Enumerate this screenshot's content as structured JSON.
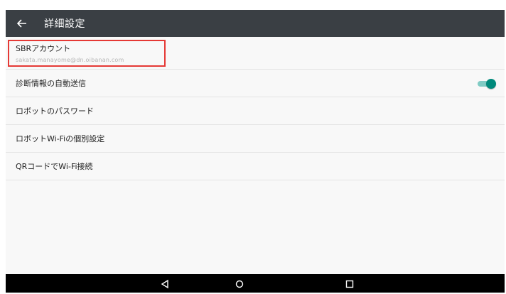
{
  "header": {
    "title": "詳細設定",
    "back_icon": "arrow-left-icon"
  },
  "settings": {
    "account": {
      "label": "SBRアカウント",
      "email": "sakata.manayome@dn.oibanan.com"
    },
    "items": [
      {
        "label": "診断情報の自動送信",
        "toggle": true
      },
      {
        "label": "ロボットのパスワード"
      },
      {
        "label": "ロボットWi-Fiの個別設定"
      },
      {
        "label": "QRコードでWi-Fi接続"
      }
    ]
  },
  "navigation": {
    "back_icon": "triangle-back-icon",
    "home_icon": "circle-home-icon",
    "recents_icon": "square-recents-icon"
  },
  "colors": {
    "appbar": "#3a3f44",
    "accent": "#00897b",
    "highlight": "#e53935"
  }
}
